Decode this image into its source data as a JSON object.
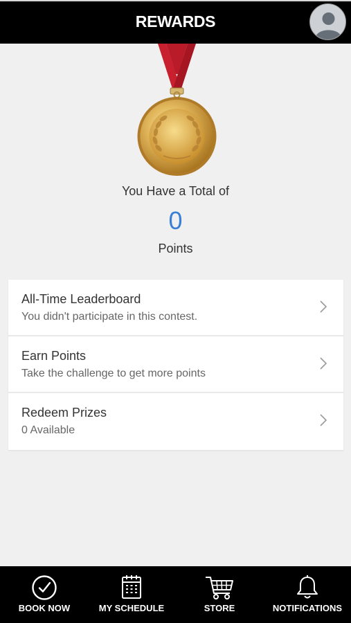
{
  "header": {
    "title": "REWARDS"
  },
  "summary": {
    "total_label": "You Have a Total of",
    "points_value": "0",
    "points_label": "Points"
  },
  "menu": {
    "items": [
      {
        "title": "All-Time Leaderboard",
        "subtitle": "You didn't participate in this contest."
      },
      {
        "title": "Earn Points",
        "subtitle": "Take the challenge to get more points"
      },
      {
        "title": "Redeem Prizes",
        "subtitle": "0 Available"
      }
    ]
  },
  "tabbar": {
    "items": [
      {
        "label": "BOOK NOW",
        "icon": "check-circle-icon"
      },
      {
        "label": "MY SCHEDULE",
        "icon": "calendar-icon"
      },
      {
        "label": "STORE",
        "icon": "cart-icon"
      },
      {
        "label": "NOTIFICATIONS",
        "icon": "bell-icon"
      }
    ]
  },
  "colors": {
    "accent": "#3a7fd5",
    "header_bg": "#000000",
    "page_bg": "#f0f0f0",
    "ribbon": "#c8202e",
    "medal_gold": "#d4a445"
  }
}
